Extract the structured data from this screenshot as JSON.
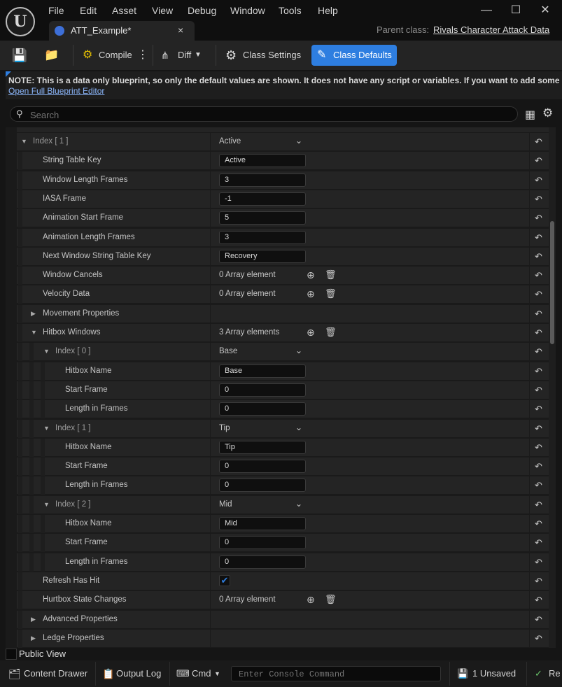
{
  "menu": [
    "File",
    "Edit",
    "Asset",
    "View",
    "Debug",
    "Window",
    "Tools",
    "Help"
  ],
  "window_controls": {
    "minimize": "—",
    "maximize": "☐",
    "close": "✕"
  },
  "tab": {
    "title": "ATT_Example*",
    "close": "×"
  },
  "parent_class": {
    "label": "Parent class:",
    "value": "Rivals Character Attack Data"
  },
  "toolbar": {
    "compile": "Compile",
    "diff": "Diff",
    "class_settings": "Class Settings",
    "class_defaults": "Class Defaults"
  },
  "notice": {
    "text": "NOTE: This is a data only blueprint, so only the default values are shown.  It does not have any script or variables.  If you want to add some",
    "link": "Open Full Blueprint Editor"
  },
  "search": {
    "placeholder": "Search"
  },
  "rows": [
    {
      "name": "Index [ 1 ]",
      "type": "dropdown",
      "value": "Active"
    },
    {
      "name": "String Table Key",
      "type": "text",
      "value": "Active"
    },
    {
      "name": "Window Length Frames",
      "type": "text",
      "value": "3"
    },
    {
      "name": "IASA Frame",
      "type": "text",
      "value": "-1"
    },
    {
      "name": "Animation Start Frame",
      "type": "text",
      "value": "5"
    },
    {
      "name": "Animation Length Frames",
      "type": "text",
      "value": "3"
    },
    {
      "name": "Next Window String Table Key",
      "type": "text",
      "value": "Recovery"
    },
    {
      "name": "Window Cancels",
      "type": "array",
      "value": "0 Array element"
    },
    {
      "name": "Velocity Data",
      "type": "array",
      "value": "0 Array element"
    },
    {
      "name": "Movement Properties",
      "type": "group",
      "value": ""
    },
    {
      "name": "Hitbox Windows",
      "type": "array",
      "value": "3 Array elements"
    },
    {
      "name": "Index [ 0 ]",
      "type": "dropdown",
      "value": "Base"
    },
    {
      "name": "Hitbox Name",
      "type": "text",
      "value": "Base"
    },
    {
      "name": "Start Frame",
      "type": "text",
      "value": "0"
    },
    {
      "name": "Length in Frames",
      "type": "text",
      "value": "0"
    },
    {
      "name": "Index [ 1 ]",
      "type": "dropdown",
      "value": "Tip"
    },
    {
      "name": "Hitbox Name",
      "type": "text",
      "value": "Tip"
    },
    {
      "name": "Start Frame",
      "type": "text",
      "value": "0"
    },
    {
      "name": "Length in Frames",
      "type": "text",
      "value": "0"
    },
    {
      "name": "Index [ 2 ]",
      "type": "dropdown",
      "value": "Mid"
    },
    {
      "name": "Hitbox Name",
      "type": "text",
      "value": "Mid"
    },
    {
      "name": "Start Frame",
      "type": "text",
      "value": "0"
    },
    {
      "name": "Length in Frames",
      "type": "text",
      "value": "0"
    },
    {
      "name": "Refresh Has Hit",
      "type": "checkbox",
      "checked": true
    },
    {
      "name": "Hurtbox State Changes",
      "type": "array",
      "value": "0 Array element"
    },
    {
      "name": "Advanced Properties",
      "type": "group",
      "value": ""
    },
    {
      "name": "Ledge Properties",
      "type": "group",
      "value": ""
    }
  ],
  "public_view": {
    "label": "Public View"
  },
  "bottom": {
    "content_drawer": "Content Drawer",
    "output_log": "Output Log",
    "cmd": "Cmd",
    "console_placeholder": "Enter Console Command",
    "unsaved": "1 Unsaved",
    "revision": "Re"
  },
  "colors": {
    "accent": "#2e7ee0",
    "panel": "#242424",
    "background": "#151515"
  }
}
